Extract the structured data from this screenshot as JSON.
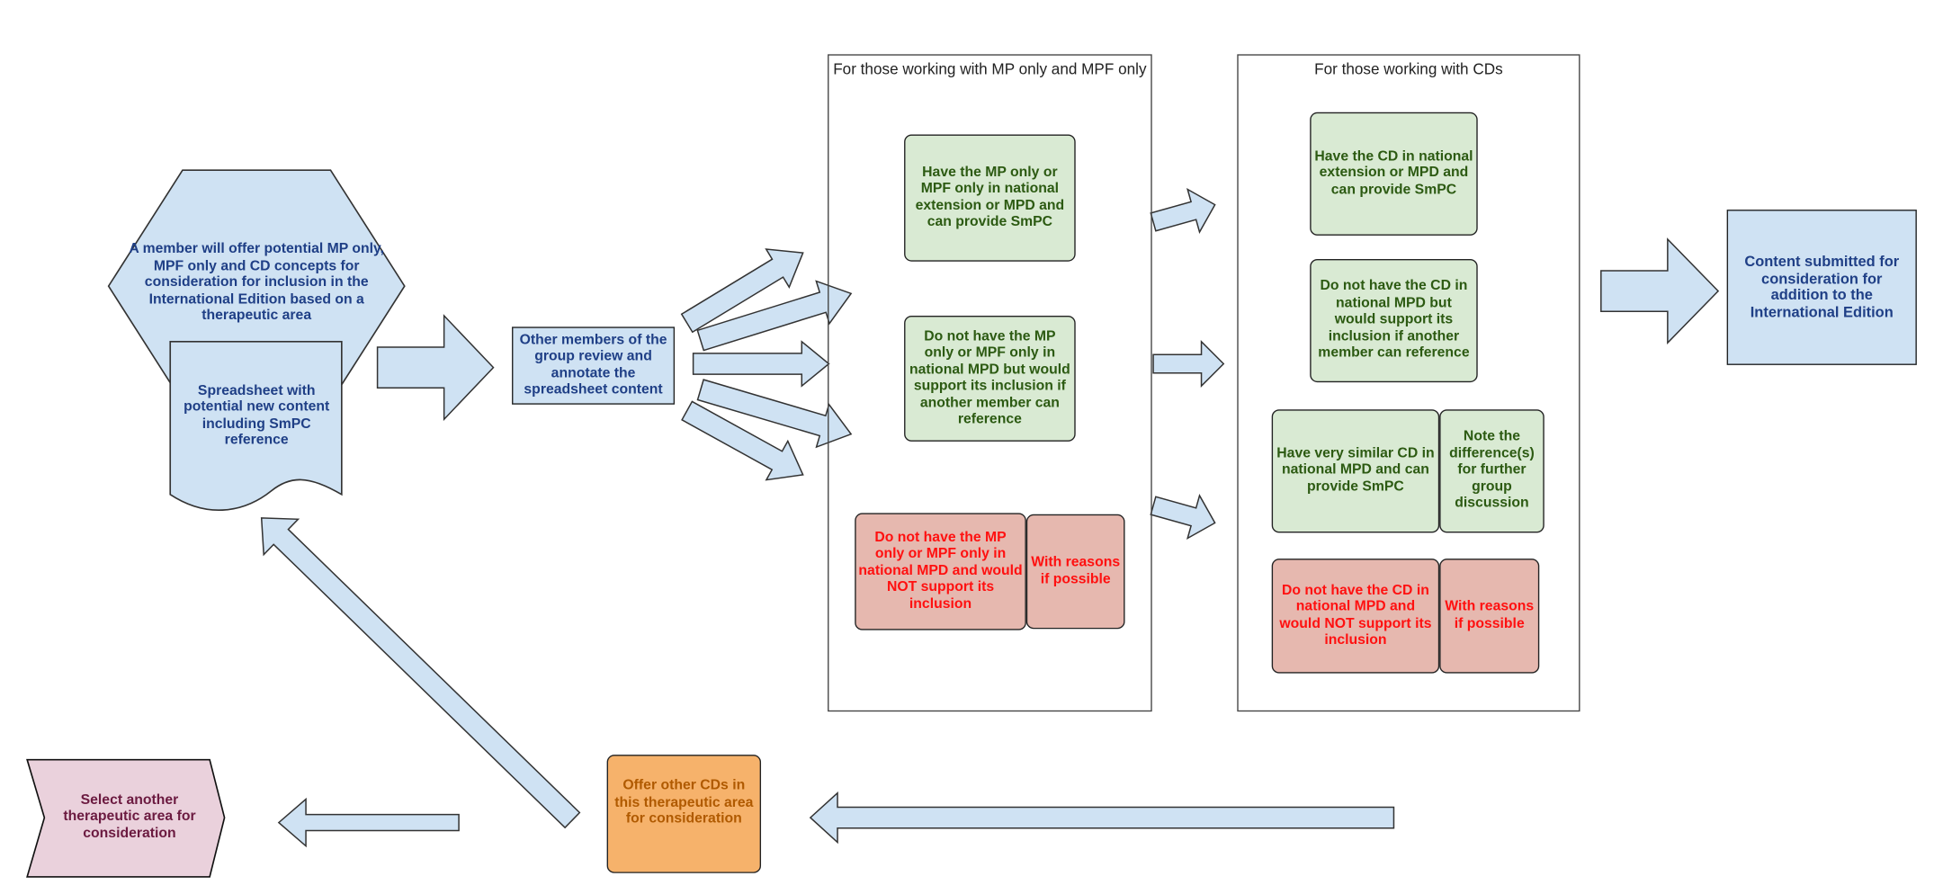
{
  "colors": {
    "blue_fill": "#cfe2f3",
    "green_fill": "#d9ead3",
    "red_fill": "#e6b8af",
    "orange_fill": "#f6b26b",
    "pink_fill": "#ead1dc"
  },
  "start": {
    "hexagon_text": "A member will offer potential MP only, MPF only and CD concepts for consideration for inclusion in the International Edition based on a therapeutic area",
    "document_text": "Spreadsheet with potential new content including SmPC reference"
  },
  "review": {
    "text": "Other members of the group review and annotate the spreadsheet content"
  },
  "panel_mp": {
    "title": "For those working with MP only and MPF only",
    "items": [
      "Have the MP only or MPF only in national extension or MPD and can provide SmPC",
      "Do not have the MP only or MPF only in national MPD but would support its inclusion if another member can reference",
      "Do not have the MP only or MPF only in national MPD and would NOT support its inclusion",
      "With reasons if possible"
    ]
  },
  "panel_cd": {
    "title": "For those working with CDs",
    "items": [
      "Have the CD in national extension or MPD and can provide SmPC",
      "Do not have the CD in national MPD but would support its inclusion if another member can reference",
      "Have very similar CD in national MPD and can provide SmPC",
      "Note the difference(s) for further group discussion",
      "Do not have the CD in national MPD and would NOT support its inclusion",
      "With reasons if possible"
    ]
  },
  "submitted": {
    "text": "Content submitted for consideration for addition to the International Edition"
  },
  "offer_other": {
    "text": "Offer other CDs in this therapeutic area for consideration"
  },
  "select_another": {
    "text": "Select another therapeutic area for consideration"
  }
}
